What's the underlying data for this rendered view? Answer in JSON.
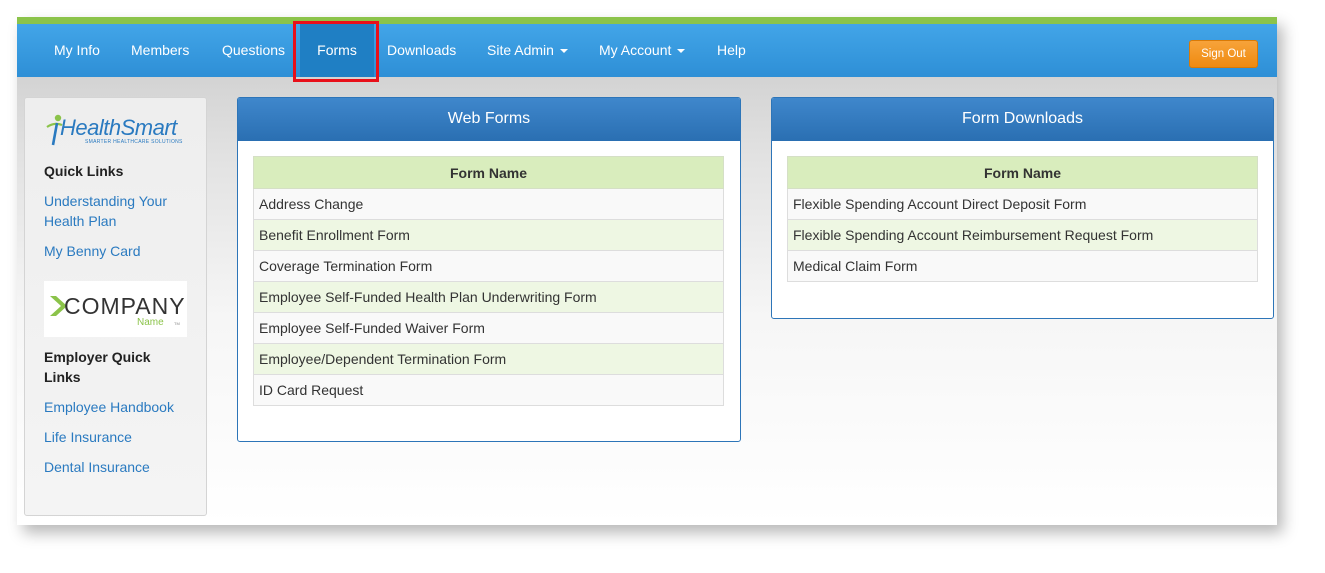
{
  "navbar": {
    "items": [
      {
        "label": "My Info"
      },
      {
        "label": "Members"
      },
      {
        "label": "Questions"
      },
      {
        "label": "Forms",
        "active": true
      },
      {
        "label": "Downloads"
      },
      {
        "label": "Site Admin",
        "dropdown": true
      },
      {
        "label": "My Account",
        "dropdown": true
      },
      {
        "label": "Help"
      }
    ],
    "signout_label": "Sign Out"
  },
  "colors": {
    "top_stripe": "#8bc34a",
    "navbar": "#2e8fd6",
    "highlight": "#e8101a",
    "signout": "#ef8a10",
    "panel_header": "#2a6fb2",
    "table_header": "#d9edbd",
    "link": "#2a7ac0"
  },
  "sidebar": {
    "logo": {
      "brand": "HealthSmart",
      "tagline": "SMARTER HEALTHCARE SOLUTIONS"
    },
    "quick_links_heading": "Quick Links",
    "quick_links": [
      "Understanding Your",
      "Health Plan",
      "My Benny Card"
    ],
    "company_logo": {
      "word": "COMPANY",
      "sub": "Name",
      "mark": "TM"
    },
    "employer_heading_line1": "Employer Quick",
    "employer_heading_line2": "Links",
    "employer_links": [
      "Employee Handbook",
      "Life Insurance",
      "Dental Insurance"
    ]
  },
  "web_forms": {
    "title": "Web Forms",
    "column_header": "Form Name",
    "rows": [
      "Address Change",
      "Benefit Enrollment Form",
      "Coverage Termination Form",
      "Employee Self-Funded Health Plan Underwriting Form",
      "Employee Self-Funded Waiver Form",
      "Employee/Dependent Termination Form",
      "ID Card Request"
    ]
  },
  "form_downloads": {
    "title": "Form Downloads",
    "column_header": "Form Name",
    "rows": [
      "Flexible Spending Account Direct Deposit Form",
      "Flexible Spending Account Reimbursement Request Form",
      "Medical Claim Form"
    ]
  }
}
